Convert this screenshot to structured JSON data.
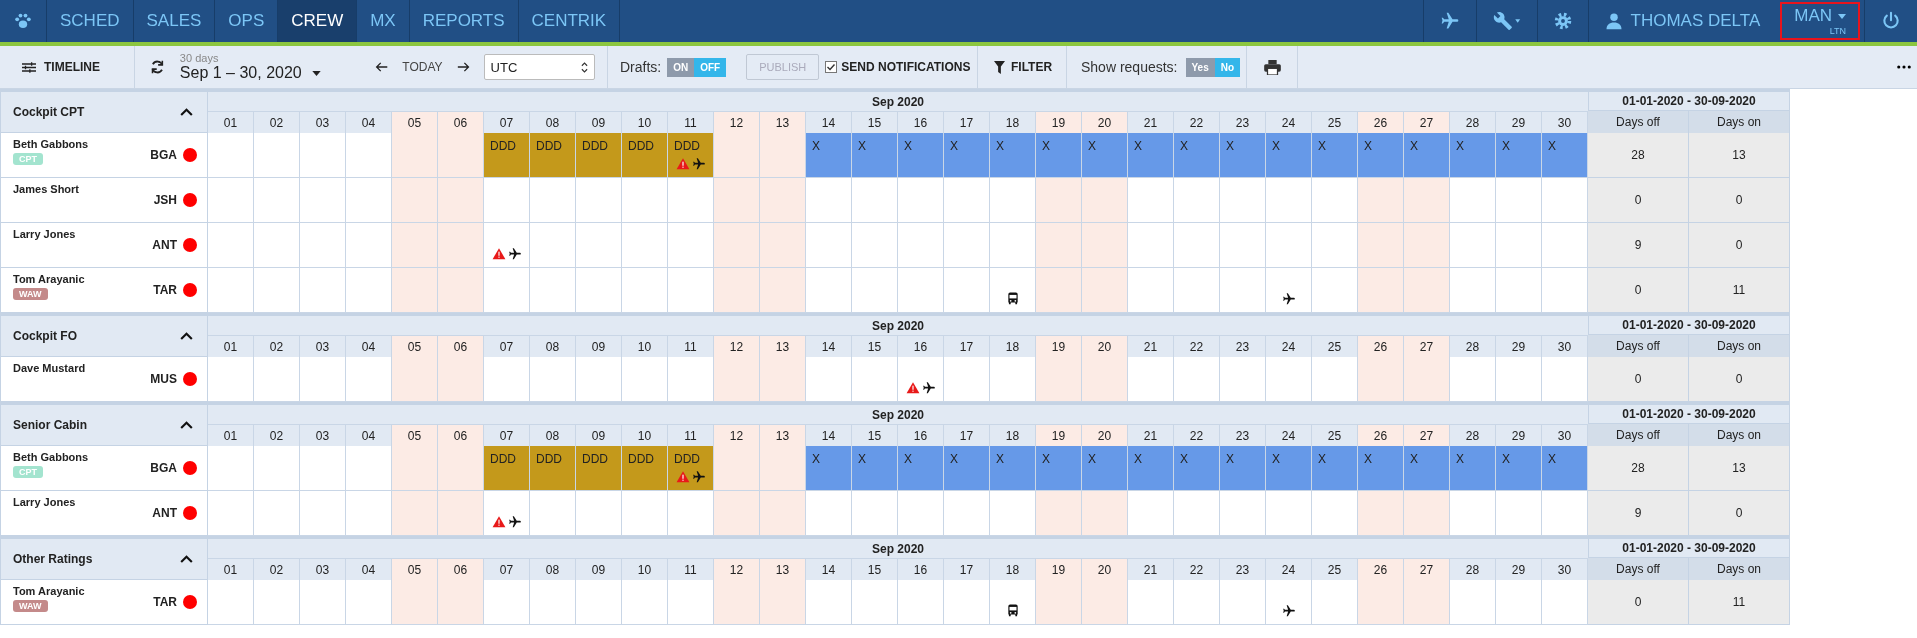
{
  "nav": {
    "tabs": [
      {
        "label": "SCHED",
        "selected": false
      },
      {
        "label": "SALES",
        "selected": false
      },
      {
        "label": "OPS",
        "selected": false
      },
      {
        "label": "CREW",
        "selected": true
      },
      {
        "label": "MX",
        "selected": false
      },
      {
        "label": "REPORTS",
        "selected": false
      },
      {
        "label": "CENTRIK",
        "selected": false
      }
    ],
    "user": "THOMAS DELTA",
    "base": {
      "label": "MAN",
      "sublabel": "LTN",
      "highlighted": true
    }
  },
  "toolbar": {
    "view": "TIMELINE",
    "range_caption": "30 days",
    "range": "Sep 1 – 30, 2020",
    "today": "TODAY",
    "timezone": "UTC",
    "drafts": {
      "label": "Drafts:",
      "options": [
        {
          "label": "ON",
          "selected": false
        },
        {
          "label": "OFF",
          "selected": true
        }
      ]
    },
    "publish": {
      "label": "PUBLISH",
      "disabled": true
    },
    "notifications": {
      "label": "SEND NOTIFICATIONS",
      "checked": true
    },
    "filter": "FILTER",
    "requests": {
      "label": "Show requests:",
      "options": [
        {
          "label": "Yes",
          "selected": false
        },
        {
          "label": "No",
          "selected": true
        }
      ]
    }
  },
  "groups": [
    {
      "name": "Cockpit CPT",
      "expanded": true,
      "month": "Sep 2020",
      "period": "01-01-2020 - 30-09-2020",
      "stat_columns": [
        "Days off",
        "Days on"
      ],
      "days": [
        {
          "label": "01",
          "weekend": false
        },
        {
          "label": "02",
          "weekend": false
        },
        {
          "label": "03",
          "weekend": false
        },
        {
          "label": "04",
          "weekend": false
        },
        {
          "label": "05",
          "weekend": true
        },
        {
          "label": "06",
          "weekend": true
        },
        {
          "label": "07",
          "weekend": false
        },
        {
          "label": "08",
          "weekend": false
        },
        {
          "label": "09",
          "weekend": false
        },
        {
          "label": "10",
          "weekend": false
        },
        {
          "label": "11",
          "weekend": false
        },
        {
          "label": "12",
          "weekend": true
        },
        {
          "label": "13",
          "weekend": true
        },
        {
          "label": "14",
          "weekend": false
        },
        {
          "label": "15",
          "weekend": false
        },
        {
          "label": "16",
          "weekend": false
        },
        {
          "label": "17",
          "weekend": false
        },
        {
          "label": "18",
          "weekend": false
        },
        {
          "label": "19",
          "weekend": true
        },
        {
          "label": "20",
          "weekend": true
        },
        {
          "label": "21",
          "weekend": false
        },
        {
          "label": "22",
          "weekend": false
        },
        {
          "label": "23",
          "weekend": false
        },
        {
          "label": "24",
          "weekend": false
        },
        {
          "label": "25",
          "weekend": false
        },
        {
          "label": "26",
          "weekend": true
        },
        {
          "label": "27",
          "weekend": true
        },
        {
          "label": "28",
          "weekend": false
        },
        {
          "label": "29",
          "weekend": false
        },
        {
          "label": "30",
          "weekend": false
        }
      ],
      "crew": [
        {
          "name": "Beth Gabbons",
          "tag": {
            "label": "CPT",
            "color": "#a3e4cf"
          },
          "code": "BGA",
          "status_dot": {
            "color": "#ff0000"
          },
          "stats": [
            "28",
            "13"
          ],
          "cells": [
            {
              "kind": "empty"
            },
            {
              "kind": "empty"
            },
            {
              "kind": "empty"
            },
            {
              "kind": "empty"
            },
            {
              "kind": "empty"
            },
            {
              "kind": "empty"
            },
            {
              "kind": "duty",
              "code": "DDD"
            },
            {
              "kind": "duty",
              "code": "DDD"
            },
            {
              "kind": "duty",
              "code": "DDD"
            },
            {
              "kind": "duty",
              "code": "DDD"
            },
            {
              "kind": "duty",
              "code": "DDD",
              "icons": [
                {
                  "kind": "warning"
                },
                {
                  "kind": "plane"
                }
              ]
            },
            {
              "kind": "empty"
            },
            {
              "kind": "empty"
            },
            {
              "kind": "off",
              "code": "X"
            },
            {
              "kind": "off",
              "code": "X"
            },
            {
              "kind": "off",
              "code": "X"
            },
            {
              "kind": "off",
              "code": "X"
            },
            {
              "kind": "off",
              "code": "X"
            },
            {
              "kind": "off",
              "code": "X"
            },
            {
              "kind": "off",
              "code": "X"
            },
            {
              "kind": "off",
              "code": "X"
            },
            {
              "kind": "off",
              "code": "X"
            },
            {
              "kind": "off",
              "code": "X"
            },
            {
              "kind": "off",
              "code": "X"
            },
            {
              "kind": "off",
              "code": "X"
            },
            {
              "kind": "off",
              "code": "X"
            },
            {
              "kind": "off",
              "code": "X"
            },
            {
              "kind": "off",
              "code": "X"
            },
            {
              "kind": "off",
              "code": "X"
            },
            {
              "kind": "off",
              "code": "X"
            }
          ]
        },
        {
          "name": "James Short",
          "code": "JSH",
          "status_dot": {
            "color": "#ff0000"
          },
          "stats": [
            "0",
            "0"
          ],
          "cells": [
            {
              "kind": "empty"
            },
            {
              "kind": "empty"
            },
            {
              "kind": "empty"
            },
            {
              "kind": "empty"
            },
            {
              "kind": "empty"
            },
            {
              "kind": "empty"
            },
            {
              "kind": "empty"
            },
            {
              "kind": "empty"
            },
            {
              "kind": "empty"
            },
            {
              "kind": "empty"
            },
            {
              "kind": "empty"
            },
            {
              "kind": "empty"
            },
            {
              "kind": "empty"
            },
            {
              "kind": "empty"
            },
            {
              "kind": "empty"
            },
            {
              "kind": "empty"
            },
            {
              "kind": "empty"
            },
            {
              "kind": "empty"
            },
            {
              "kind": "empty"
            },
            {
              "kind": "empty"
            },
            {
              "kind": "empty"
            },
            {
              "kind": "empty"
            },
            {
              "kind": "empty"
            },
            {
              "kind": "empty"
            },
            {
              "kind": "empty"
            },
            {
              "kind": "empty"
            },
            {
              "kind": "empty"
            },
            {
              "kind": "empty"
            },
            {
              "kind": "empty"
            },
            {
              "kind": "empty"
            }
          ]
        },
        {
          "name": "Larry Jones",
          "code": "ANT",
          "status_dot": {
            "color": "#ff0000"
          },
          "stats": [
            "9",
            "0"
          ],
          "cells": [
            {
              "kind": "empty"
            },
            {
              "kind": "empty"
            },
            {
              "kind": "empty"
            },
            {
              "kind": "empty"
            },
            {
              "kind": "empty"
            },
            {
              "kind": "empty"
            },
            {
              "kind": "empty",
              "icons": [
                {
                  "kind": "warning"
                },
                {
                  "kind": "plane"
                }
              ]
            },
            {
              "kind": "empty"
            },
            {
              "kind": "empty"
            },
            {
              "kind": "empty"
            },
            {
              "kind": "empty"
            },
            {
              "kind": "empty"
            },
            {
              "kind": "empty"
            },
            {
              "kind": "empty"
            },
            {
              "kind": "empty"
            },
            {
              "kind": "empty"
            },
            {
              "kind": "empty"
            },
            {
              "kind": "empty"
            },
            {
              "kind": "empty"
            },
            {
              "kind": "empty"
            },
            {
              "kind": "empty"
            },
            {
              "kind": "empty"
            },
            {
              "kind": "empty"
            },
            {
              "kind": "empty"
            },
            {
              "kind": "empty"
            },
            {
              "kind": "empty"
            },
            {
              "kind": "empty"
            },
            {
              "kind": "empty"
            },
            {
              "kind": "empty"
            },
            {
              "kind": "empty"
            }
          ]
        },
        {
          "name": "Tom Arayanic",
          "tag": {
            "label": "WAW",
            "color": "#c48a8a"
          },
          "code": "TAR",
          "status_dot": {
            "color": "#ff0000"
          },
          "stats": [
            "0",
            "11"
          ],
          "cells": [
            {
              "kind": "empty"
            },
            {
              "kind": "empty"
            },
            {
              "kind": "empty"
            },
            {
              "kind": "empty"
            },
            {
              "kind": "empty"
            },
            {
              "kind": "empty"
            },
            {
              "kind": "empty"
            },
            {
              "kind": "empty"
            },
            {
              "kind": "empty"
            },
            {
              "kind": "empty"
            },
            {
              "kind": "empty"
            },
            {
              "kind": "empty"
            },
            {
              "kind": "empty"
            },
            {
              "kind": "empty"
            },
            {
              "kind": "empty"
            },
            {
              "kind": "empty"
            },
            {
              "kind": "empty"
            },
            {
              "kind": "empty",
              "icons": [
                {
                  "kind": "bus"
                }
              ]
            },
            {
              "kind": "empty"
            },
            {
              "kind": "empty"
            },
            {
              "kind": "empty"
            },
            {
              "kind": "empty"
            },
            {
              "kind": "empty"
            },
            {
              "kind": "empty",
              "icons": [
                {
                  "kind": "plane"
                }
              ]
            },
            {
              "kind": "empty"
            },
            {
              "kind": "empty"
            },
            {
              "kind": "empty"
            },
            {
              "kind": "empty"
            },
            {
              "kind": "empty"
            },
            {
              "kind": "empty"
            }
          ]
        }
      ]
    },
    {
      "name": "Cockpit FO",
      "expanded": true,
      "month": "Sep 2020",
      "period": "01-01-2020 - 30-09-2020",
      "stat_columns": [
        "Days off",
        "Days on"
      ],
      "days": [
        {
          "label": "01",
          "weekend": false
        },
        {
          "label": "02",
          "weekend": false
        },
        {
          "label": "03",
          "weekend": false
        },
        {
          "label": "04",
          "weekend": false
        },
        {
          "label": "05",
          "weekend": true
        },
        {
          "label": "06",
          "weekend": true
        },
        {
          "label": "07",
          "weekend": false
        },
        {
          "label": "08",
          "weekend": false
        },
        {
          "label": "09",
          "weekend": false
        },
        {
          "label": "10",
          "weekend": false
        },
        {
          "label": "11",
          "weekend": false
        },
        {
          "label": "12",
          "weekend": true
        },
        {
          "label": "13",
          "weekend": true
        },
        {
          "label": "14",
          "weekend": false
        },
        {
          "label": "15",
          "weekend": false
        },
        {
          "label": "16",
          "weekend": false
        },
        {
          "label": "17",
          "weekend": false
        },
        {
          "label": "18",
          "weekend": false
        },
        {
          "label": "19",
          "weekend": true
        },
        {
          "label": "20",
          "weekend": true
        },
        {
          "label": "21",
          "weekend": false
        },
        {
          "label": "22",
          "weekend": false
        },
        {
          "label": "23",
          "weekend": false
        },
        {
          "label": "24",
          "weekend": false
        },
        {
          "label": "25",
          "weekend": false
        },
        {
          "label": "26",
          "weekend": true
        },
        {
          "label": "27",
          "weekend": true
        },
        {
          "label": "28",
          "weekend": false
        },
        {
          "label": "29",
          "weekend": false
        },
        {
          "label": "30",
          "weekend": false
        }
      ],
      "crew": [
        {
          "name": "Dave Mustard",
          "code": "MUS",
          "status_dot": {
            "color": "#ff0000"
          },
          "stats": [
            "0",
            "0"
          ],
          "cells": [
            {
              "kind": "empty"
            },
            {
              "kind": "empty"
            },
            {
              "kind": "empty"
            },
            {
              "kind": "empty"
            },
            {
              "kind": "empty"
            },
            {
              "kind": "empty"
            },
            {
              "kind": "empty"
            },
            {
              "kind": "empty"
            },
            {
              "kind": "empty"
            },
            {
              "kind": "empty"
            },
            {
              "kind": "empty"
            },
            {
              "kind": "empty"
            },
            {
              "kind": "empty"
            },
            {
              "kind": "empty"
            },
            {
              "kind": "empty"
            },
            {
              "kind": "empty",
              "icons": [
                {
                  "kind": "warning"
                },
                {
                  "kind": "plane"
                }
              ]
            },
            {
              "kind": "empty"
            },
            {
              "kind": "empty"
            },
            {
              "kind": "empty"
            },
            {
              "kind": "empty"
            },
            {
              "kind": "empty"
            },
            {
              "kind": "empty"
            },
            {
              "kind": "empty"
            },
            {
              "kind": "empty"
            },
            {
              "kind": "empty"
            },
            {
              "kind": "empty"
            },
            {
              "kind": "empty"
            },
            {
              "kind": "empty"
            },
            {
              "kind": "empty"
            },
            {
              "kind": "empty"
            }
          ]
        }
      ]
    },
    {
      "name": "Senior Cabin",
      "expanded": true,
      "month": "Sep 2020",
      "period": "01-01-2020 - 30-09-2020",
      "stat_columns": [
        "Days off",
        "Days on"
      ],
      "days": [
        {
          "label": "01",
          "weekend": false
        },
        {
          "label": "02",
          "weekend": false
        },
        {
          "label": "03",
          "weekend": false
        },
        {
          "label": "04",
          "weekend": false
        },
        {
          "label": "05",
          "weekend": true
        },
        {
          "label": "06",
          "weekend": true
        },
        {
          "label": "07",
          "weekend": false
        },
        {
          "label": "08",
          "weekend": false
        },
        {
          "label": "09",
          "weekend": false
        },
        {
          "label": "10",
          "weekend": false
        },
        {
          "label": "11",
          "weekend": false
        },
        {
          "label": "12",
          "weekend": true
        },
        {
          "label": "13",
          "weekend": true
        },
        {
          "label": "14",
          "weekend": false
        },
        {
          "label": "15",
          "weekend": false
        },
        {
          "label": "16",
          "weekend": false
        },
        {
          "label": "17",
          "weekend": false
        },
        {
          "label": "18",
          "weekend": false
        },
        {
          "label": "19",
          "weekend": true
        },
        {
          "label": "20",
          "weekend": true
        },
        {
          "label": "21",
          "weekend": false
        },
        {
          "label": "22",
          "weekend": false
        },
        {
          "label": "23",
          "weekend": false
        },
        {
          "label": "24",
          "weekend": false
        },
        {
          "label": "25",
          "weekend": false
        },
        {
          "label": "26",
          "weekend": true
        },
        {
          "label": "27",
          "weekend": true
        },
        {
          "label": "28",
          "weekend": false
        },
        {
          "label": "29",
          "weekend": false
        },
        {
          "label": "30",
          "weekend": false
        }
      ],
      "crew": [
        {
          "name": "Beth Gabbons",
          "tag": {
            "label": "CPT",
            "color": "#a3e4cf"
          },
          "code": "BGA",
          "status_dot": {
            "color": "#ff0000"
          },
          "stats": [
            "28",
            "13"
          ],
          "cells": [
            {
              "kind": "empty"
            },
            {
              "kind": "empty"
            },
            {
              "kind": "empty"
            },
            {
              "kind": "empty"
            },
            {
              "kind": "empty"
            },
            {
              "kind": "empty"
            },
            {
              "kind": "duty",
              "code": "DDD"
            },
            {
              "kind": "duty",
              "code": "DDD"
            },
            {
              "kind": "duty",
              "code": "DDD"
            },
            {
              "kind": "duty",
              "code": "DDD"
            },
            {
              "kind": "duty",
              "code": "DDD",
              "icons": [
                {
                  "kind": "warning"
                },
                {
                  "kind": "plane"
                }
              ]
            },
            {
              "kind": "empty"
            },
            {
              "kind": "empty"
            },
            {
              "kind": "off",
              "code": "X"
            },
            {
              "kind": "off",
              "code": "X"
            },
            {
              "kind": "off",
              "code": "X"
            },
            {
              "kind": "off",
              "code": "X"
            },
            {
              "kind": "off",
              "code": "X"
            },
            {
              "kind": "off",
              "code": "X"
            },
            {
              "kind": "off",
              "code": "X"
            },
            {
              "kind": "off",
              "code": "X"
            },
            {
              "kind": "off",
              "code": "X"
            },
            {
              "kind": "off",
              "code": "X"
            },
            {
              "kind": "off",
              "code": "X"
            },
            {
              "kind": "off",
              "code": "X"
            },
            {
              "kind": "off",
              "code": "X"
            },
            {
              "kind": "off",
              "code": "X"
            },
            {
              "kind": "off",
              "code": "X"
            },
            {
              "kind": "off",
              "code": "X"
            },
            {
              "kind": "off",
              "code": "X"
            }
          ]
        },
        {
          "name": "Larry Jones",
          "code": "ANT",
          "status_dot": {
            "color": "#ff0000"
          },
          "stats": [
            "9",
            "0"
          ],
          "cells": [
            {
              "kind": "empty"
            },
            {
              "kind": "empty"
            },
            {
              "kind": "empty"
            },
            {
              "kind": "empty"
            },
            {
              "kind": "empty"
            },
            {
              "kind": "empty"
            },
            {
              "kind": "empty",
              "icons": [
                {
                  "kind": "warning"
                },
                {
                  "kind": "plane"
                }
              ]
            },
            {
              "kind": "empty"
            },
            {
              "kind": "empty"
            },
            {
              "kind": "empty"
            },
            {
              "kind": "empty"
            },
            {
              "kind": "empty"
            },
            {
              "kind": "empty"
            },
            {
              "kind": "empty"
            },
            {
              "kind": "empty"
            },
            {
              "kind": "empty"
            },
            {
              "kind": "empty"
            },
            {
              "kind": "empty"
            },
            {
              "kind": "empty"
            },
            {
              "kind": "empty"
            },
            {
              "kind": "empty"
            },
            {
              "kind": "empty"
            },
            {
              "kind": "empty"
            },
            {
              "kind": "empty"
            },
            {
              "kind": "empty"
            },
            {
              "kind": "empty"
            },
            {
              "kind": "empty"
            },
            {
              "kind": "empty"
            },
            {
              "kind": "empty"
            },
            {
              "kind": "empty"
            }
          ]
        }
      ]
    },
    {
      "name": "Other Ratings",
      "expanded": true,
      "month": "Sep 2020",
      "period": "01-01-2020 - 30-09-2020",
      "stat_columns": [
        "Days off",
        "Days on"
      ],
      "days": [
        {
          "label": "01",
          "weekend": false
        },
        {
          "label": "02",
          "weekend": false
        },
        {
          "label": "03",
          "weekend": false
        },
        {
          "label": "04",
          "weekend": false
        },
        {
          "label": "05",
          "weekend": true
        },
        {
          "label": "06",
          "weekend": true
        },
        {
          "label": "07",
          "weekend": false
        },
        {
          "label": "08",
          "weekend": false
        },
        {
          "label": "09",
          "weekend": false
        },
        {
          "label": "10",
          "weekend": false
        },
        {
          "label": "11",
          "weekend": false
        },
        {
          "label": "12",
          "weekend": true
        },
        {
          "label": "13",
          "weekend": true
        },
        {
          "label": "14",
          "weekend": false
        },
        {
          "label": "15",
          "weekend": false
        },
        {
          "label": "16",
          "weekend": false
        },
        {
          "label": "17",
          "weekend": false
        },
        {
          "label": "18",
          "weekend": false
        },
        {
          "label": "19",
          "weekend": true
        },
        {
          "label": "20",
          "weekend": true
        },
        {
          "label": "21",
          "weekend": false
        },
        {
          "label": "22",
          "weekend": false
        },
        {
          "label": "23",
          "weekend": false
        },
        {
          "label": "24",
          "weekend": false
        },
        {
          "label": "25",
          "weekend": false
        },
        {
          "label": "26",
          "weekend": true
        },
        {
          "label": "27",
          "weekend": true
        },
        {
          "label": "28",
          "weekend": false
        },
        {
          "label": "29",
          "weekend": false
        },
        {
          "label": "30",
          "weekend": false
        }
      ],
      "crew": [
        {
          "name": "Tom Arayanic",
          "tag": {
            "label": "WAW",
            "color": "#c48a8a"
          },
          "code": "TAR",
          "status_dot": {
            "color": "#ff0000"
          },
          "stats": [
            "0",
            "11"
          ],
          "cells": [
            {
              "kind": "empty"
            },
            {
              "kind": "empty"
            },
            {
              "kind": "empty"
            },
            {
              "kind": "empty"
            },
            {
              "kind": "empty"
            },
            {
              "kind": "empty"
            },
            {
              "kind": "empty"
            },
            {
              "kind": "empty"
            },
            {
              "kind": "empty"
            },
            {
              "kind": "empty"
            },
            {
              "kind": "empty"
            },
            {
              "kind": "empty"
            },
            {
              "kind": "empty"
            },
            {
              "kind": "empty"
            },
            {
              "kind": "empty"
            },
            {
              "kind": "empty"
            },
            {
              "kind": "empty"
            },
            {
              "kind": "empty",
              "icons": [
                {
                  "kind": "bus"
                }
              ]
            },
            {
              "kind": "empty"
            },
            {
              "kind": "empty"
            },
            {
              "kind": "empty"
            },
            {
              "kind": "empty"
            },
            {
              "kind": "empty"
            },
            {
              "kind": "empty",
              "icons": [
                {
                  "kind": "plane"
                }
              ]
            },
            {
              "kind": "empty"
            },
            {
              "kind": "empty"
            },
            {
              "kind": "empty"
            },
            {
              "kind": "empty"
            },
            {
              "kind": "empty"
            },
            {
              "kind": "empty"
            }
          ]
        }
      ]
    }
  ]
}
